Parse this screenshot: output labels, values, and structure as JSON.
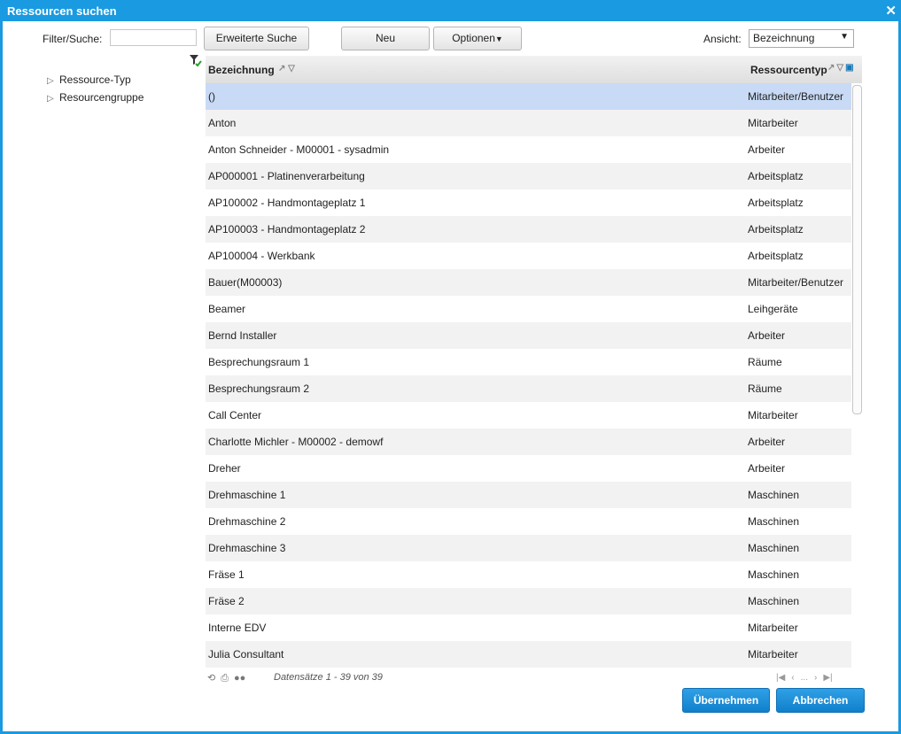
{
  "window": {
    "title": "Ressourcen suchen",
    "close_label": "✕"
  },
  "toolbar": {
    "filter_label": "Filter/Suche:",
    "filter_value": "",
    "extended_search": "Erweiterte Suche",
    "new": "Neu",
    "options": "Optionen",
    "view_label": "Ansicht:",
    "view_value": "Bezeichnung",
    "view_arrow": "▼"
  },
  "tree": {
    "items": [
      {
        "label": "Ressource-Typ"
      },
      {
        "label": "Resourcengruppe"
      }
    ]
  },
  "grid": {
    "col_bez": "Bezeichnung",
    "col_typ": "Ressourcentyp",
    "rows": [
      {
        "bez": "()",
        "typ": "Mitarbeiter/Benutzer"
      },
      {
        "bez": "Anton",
        "typ": "Mitarbeiter"
      },
      {
        "bez": "Anton Schneider - M00001 - sysadmin",
        "typ": "Arbeiter"
      },
      {
        "bez": "AP000001 - Platinenverarbeitung",
        "typ": "Arbeitsplatz"
      },
      {
        "bez": "AP100002 - Handmontageplatz 1",
        "typ": "Arbeitsplatz"
      },
      {
        "bez": "AP100003 - Handmontageplatz 2",
        "typ": "Arbeitsplatz"
      },
      {
        "bez": "AP100004 - Werkbank",
        "typ": "Arbeitsplatz"
      },
      {
        "bez": "Bauer(M00003)",
        "typ": "Mitarbeiter/Benutzer"
      },
      {
        "bez": "Beamer",
        "typ": "Leihgeräte"
      },
      {
        "bez": "Bernd Installer",
        "typ": "Arbeiter"
      },
      {
        "bez": "Besprechungsraum 1",
        "typ": "Räume"
      },
      {
        "bez": "Besprechungsraum 2",
        "typ": "Räume"
      },
      {
        "bez": "Call Center",
        "typ": "Mitarbeiter"
      },
      {
        "bez": "Charlotte Michler - M00002 - demowf",
        "typ": "Arbeiter"
      },
      {
        "bez": "Dreher",
        "typ": "Arbeiter"
      },
      {
        "bez": "Drehmaschine 1",
        "typ": "Maschinen"
      },
      {
        "bez": "Drehmaschine 2",
        "typ": "Maschinen"
      },
      {
        "bez": "Drehmaschine 3",
        "typ": "Maschinen"
      },
      {
        "bez": "Fräse 1",
        "typ": "Maschinen"
      },
      {
        "bez": "Fräse 2",
        "typ": "Maschinen"
      },
      {
        "bez": "Interne EDV",
        "typ": "Mitarbeiter"
      },
      {
        "bez": "Julia Consultant",
        "typ": "Mitarbeiter"
      }
    ]
  },
  "footer": {
    "records": "Datensätze 1 - 39 von 39",
    "pager_ellipsis": "..."
  },
  "actions": {
    "apply": "Übernehmen",
    "cancel": "Abbrechen"
  },
  "colors": {
    "accent": "#1a9ae0",
    "selected_row": "#c8daf5"
  }
}
